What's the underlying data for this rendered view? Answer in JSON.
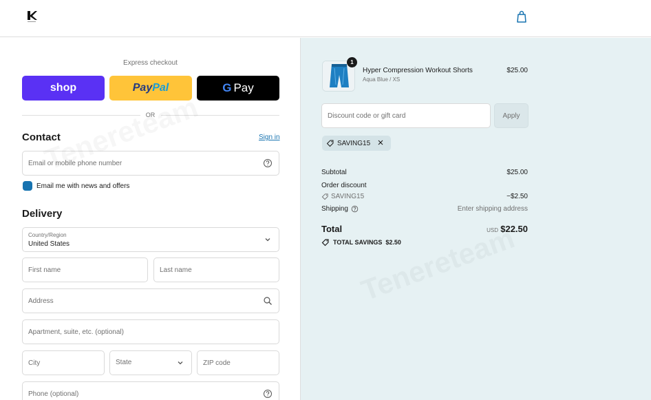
{
  "header": {
    "logo_icon": "brand-logo-icon",
    "cart_icon": "shopping-bag-icon"
  },
  "express": {
    "title": "Express checkout",
    "shop_label": "shop",
    "paypal_label_1": "Pay",
    "paypal_label_2": "Pal",
    "gpay_g": "G",
    "gpay_label": "Pay",
    "divider": "OR"
  },
  "contact": {
    "title": "Contact",
    "sign_in": "Sign in",
    "email_placeholder": "Email or mobile phone number",
    "newsletter_label": "Email me with news and offers",
    "newsletter_checked": true
  },
  "delivery": {
    "title": "Delivery",
    "country_label": "Country/Region",
    "country_value": "United States",
    "first_name_placeholder": "First name",
    "last_name_placeholder": "Last name",
    "address_placeholder": "Address",
    "apartment_placeholder": "Apartment, suite, etc. (optional)",
    "city_placeholder": "City",
    "state_placeholder": "State",
    "zip_placeholder": "ZIP code",
    "phone_placeholder": "Phone (optional)"
  },
  "summary": {
    "product": {
      "name": "Hyper Compression Workout Shorts",
      "variant": "Aqua Blue / XS",
      "price": "$25.00",
      "quantity": "1"
    },
    "discount_placeholder": "Discount code or gift card",
    "apply_label": "Apply",
    "applied_code": "SAVING15",
    "subtotal_label": "Subtotal",
    "subtotal_value": "$25.00",
    "order_discount_label": "Order discount",
    "discount_code": "SAVING15",
    "discount_value": "−$2.50",
    "shipping_label": "Shipping",
    "shipping_value": "Enter shipping address",
    "total_label": "Total",
    "total_currency": "USD",
    "total_value": "$22.50",
    "savings_label": "TOTAL SAVINGS",
    "savings_value": "$2.50"
  },
  "watermark": "Tenereteam",
  "colors": {
    "shop": "#5a31f4",
    "paypal": "#ffc439",
    "gpay": "#000000",
    "link": "#1773b0",
    "summary_bg": "#e6f1f3"
  }
}
